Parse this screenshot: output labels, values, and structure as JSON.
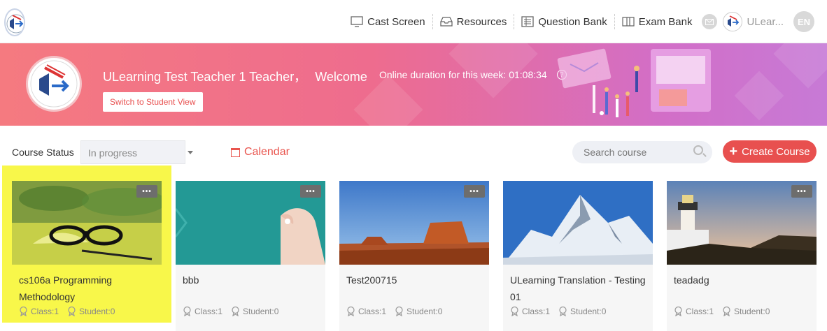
{
  "nav": {
    "items": [
      {
        "label": "Cast Screen",
        "icon": "monitor-icon"
      },
      {
        "label": "Resources",
        "icon": "inbox-icon"
      },
      {
        "label": "Question Bank",
        "icon": "list-icon"
      },
      {
        "label": "Exam Bank",
        "icon": "book-icon"
      }
    ],
    "user_name": "ULear...",
    "lang": "EN"
  },
  "banner": {
    "welcome_name": "ULearning Test Teacher 1 Teacher，",
    "welcome_word": "Welcome",
    "online_label": "Online duration for this week: 01:08:34",
    "switch_label": "Switch to Student View"
  },
  "filter": {
    "status_label": "Course Status",
    "status_value": "In progress",
    "calendar_label": "Calendar",
    "search_placeholder": "Search course",
    "create_label": "Create Course"
  },
  "courses": [
    {
      "title": "cs106a Programming Methodology",
      "class": "Class:1",
      "student": "Student:0",
      "highlighted": true
    },
    {
      "title": "bbb",
      "class": "Class:1",
      "student": "Student:0",
      "highlighted": false
    },
    {
      "title": "Test200715",
      "class": "Class:1",
      "student": "Student:0",
      "highlighted": false
    },
    {
      "title": "ULearning Translation - Testing 01",
      "class": "Class:1",
      "student": "Student:0",
      "highlighted": false
    },
    {
      "title": "teadadg",
      "class": "Class:1",
      "student": "Student:0",
      "highlighted": false
    }
  ],
  "colors": {
    "accent": "#e8504f",
    "highlight": "#f8f74a"
  },
  "more_label": "•••"
}
